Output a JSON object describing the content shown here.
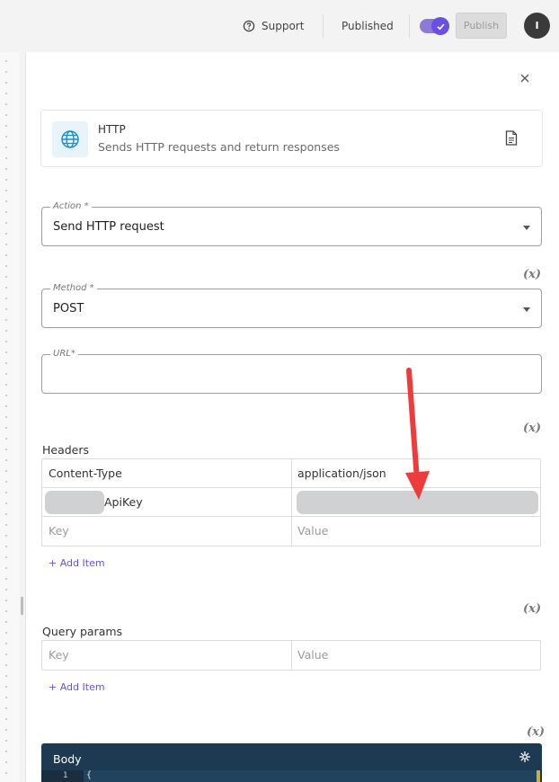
{
  "topbar": {
    "support_label": "Support",
    "published_label": "Published",
    "publish_button": "Publish",
    "avatar_initial": "I",
    "toggle_on": true,
    "accent_color": "#6a4fe0"
  },
  "panel": {
    "close_icon": "close-icon"
  },
  "app_card": {
    "title": "HTTP",
    "subtitle": "Sends HTTP requests and return responses",
    "icon": "globe-icon",
    "doc_icon": "document-icon"
  },
  "fields": {
    "action": {
      "label": "Action *",
      "value": "Send HTTP request"
    },
    "method": {
      "label": "Method *",
      "value": "POST"
    },
    "url": {
      "label": "URL*",
      "value": ""
    },
    "variable_symbol": "(x)"
  },
  "headers": {
    "label": "Headers",
    "rows": [
      {
        "key": "Content-Type",
        "value": "application/json"
      },
      {
        "key": "ApiKey",
        "value": ""
      }
    ],
    "key_placeholder": "Key",
    "value_placeholder": "Value",
    "add_item": "+ Add Item"
  },
  "query_params": {
    "label": "Query params",
    "key_placeholder": "Key",
    "value_placeholder": "Value",
    "add_item": "+ Add Item"
  },
  "body": {
    "title": "Body",
    "line_number": "1",
    "code": "{"
  }
}
